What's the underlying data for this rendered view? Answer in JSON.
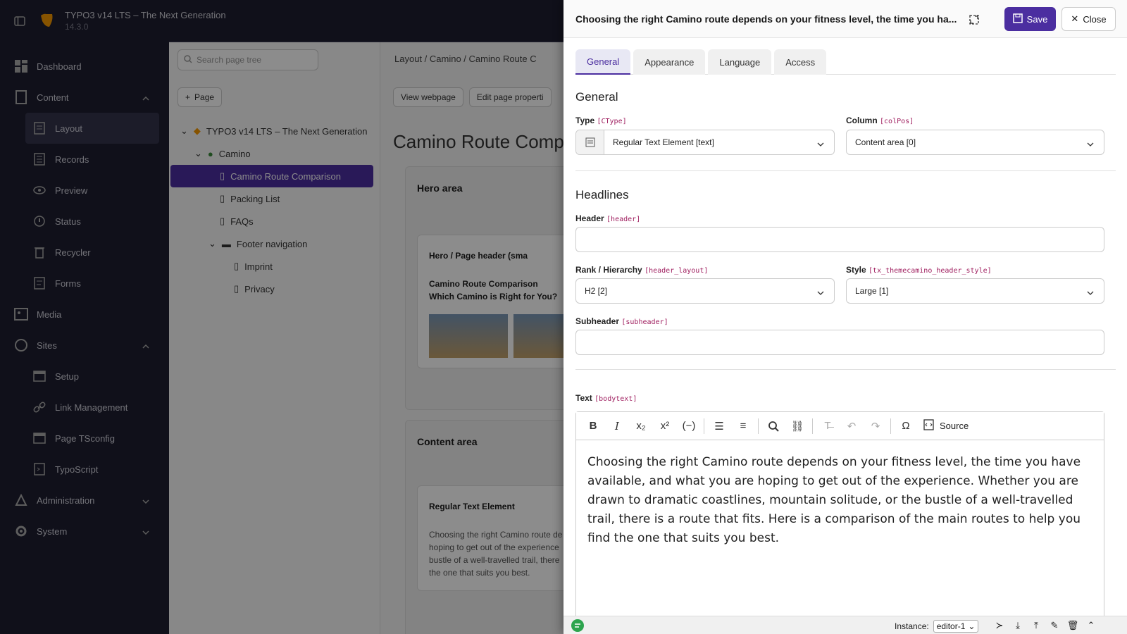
{
  "app": {
    "title": "TYPO3 v14 LTS – The Next Generation",
    "version": "14.3.0"
  },
  "sidebar": {
    "items": [
      {
        "label": "Dashboard",
        "icon": "dashboard-icon"
      },
      {
        "label": "Content",
        "icon": "content-icon"
      },
      {
        "label": "Layout",
        "icon": "layout-icon"
      },
      {
        "label": "Records",
        "icon": "records-icon"
      },
      {
        "label": "Preview",
        "icon": "preview-icon"
      },
      {
        "label": "Status",
        "icon": "status-icon"
      },
      {
        "label": "Recycler",
        "icon": "recycler-icon"
      },
      {
        "label": "Forms",
        "icon": "forms-icon"
      },
      {
        "label": "Media",
        "icon": "media-icon"
      },
      {
        "label": "Sites",
        "icon": "sites-icon"
      },
      {
        "label": "Setup",
        "icon": "setup-icon"
      },
      {
        "label": "Link Management",
        "icon": "link-icon"
      },
      {
        "label": "Page TSconfig",
        "icon": "tsconfig-icon"
      },
      {
        "label": "TypoScript",
        "icon": "typoscript-icon"
      },
      {
        "label": "Administration",
        "icon": "administration-icon"
      },
      {
        "label": "System",
        "icon": "system-icon"
      }
    ]
  },
  "tree": {
    "search_placeholder": "Search page tree",
    "new_page": "Page",
    "nodes": [
      {
        "label": "TYPO3 v14 LTS – The Next Generation"
      },
      {
        "label": "Camino"
      },
      {
        "label": "Camino Route Comparison"
      },
      {
        "label": "Packing List"
      },
      {
        "label": "FAQs"
      },
      {
        "label": "Footer navigation"
      },
      {
        "label": "Imprint"
      },
      {
        "label": "Privacy"
      }
    ]
  },
  "page": {
    "breadcrumb": [
      "Layout",
      "Camino",
      "Camino Route C"
    ],
    "view_webpage": "View webpage",
    "edit_props": "Edit page properti",
    "title": "Camino Route Compa",
    "hero": {
      "heading": "Hero area",
      "card_title": "Hero / Page header (sma",
      "line1": "Camino Route Comparison",
      "line2": "Which Camino is Right for You?"
    },
    "content": {
      "heading": "Content area",
      "card_title": "Regular Text Element",
      "lines": [
        "Choosing the right Camino route de",
        "hoping to get out of the experience",
        "bustle of a well-travelled trail, there",
        "the one that suits you best."
      ]
    }
  },
  "panel": {
    "title": "Choosing the right Camino route depends on your fitness level, the time you ha...",
    "save": "Save",
    "close": "Close",
    "tabs": [
      "General",
      "Appearance",
      "Language",
      "Access"
    ],
    "section_general": "General",
    "type_label": "Type",
    "type_key": "[CType]",
    "type_value": "Regular Text Element [text]",
    "col_label": "Column",
    "col_key": "[colPos]",
    "col_value": "Content area [0]",
    "section_headlines": "Headlines",
    "header_label": "Header",
    "header_key": "[header]",
    "header_value": "",
    "rank_label": "Rank / Hierarchy",
    "rank_key": "[header_layout]",
    "rank_value": "H2 [2]",
    "style_label": "Style",
    "style_key": "[tx_themecamino_header_style]",
    "style_value": "Large [1]",
    "sub_label": "Subheader",
    "sub_key": "[subheader]",
    "sub_value": "",
    "text_label": "Text",
    "text_key": "[bodytext]",
    "source": "Source",
    "bodytext": "Choosing the right Camino route depends on your fitness level, the time you have available, and what you are hoping to get out of the experience. Whether you are drawn to dramatic coastlines, mountain solitude, or the bustle of a well-travelled trail, there is a route that fits. Here is a comparison of the main routes to help you find the one that suits you best."
  },
  "statusbar": {
    "instance_label": "Instance:",
    "instance_value": "editor-1"
  },
  "colors": {
    "accent": "#4b2ea0",
    "sidebar": "#1e1e30",
    "key": "#a02060"
  }
}
